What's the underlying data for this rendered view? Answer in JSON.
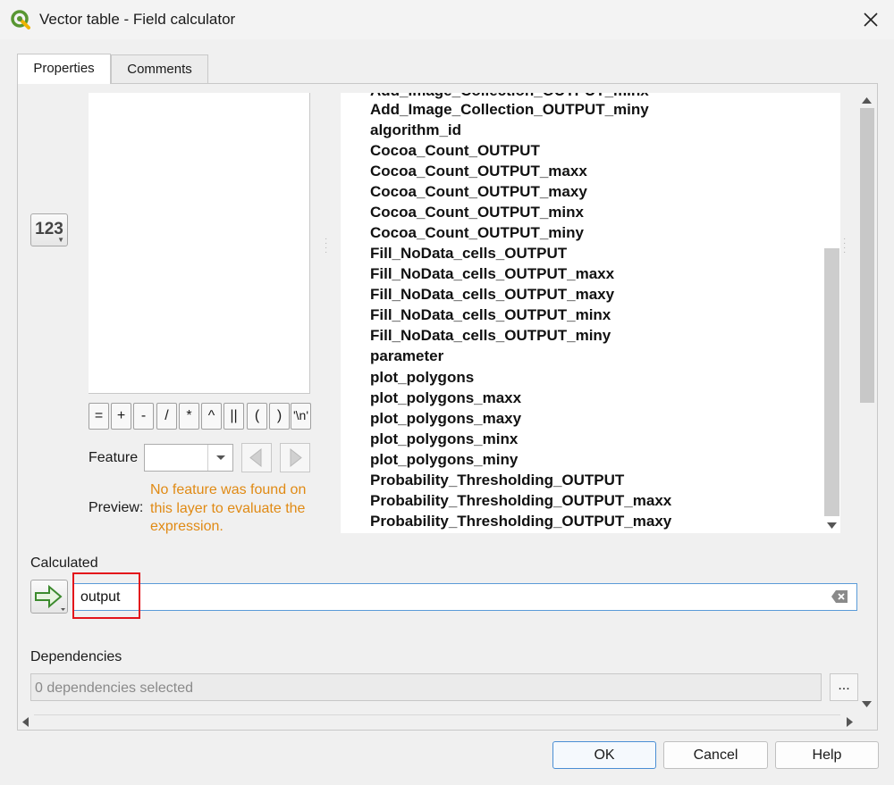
{
  "window": {
    "title": "Vector table - Field calculator",
    "app_icon": "qgis-logo-icon",
    "close_icon": "close-icon"
  },
  "tabs": [
    {
      "label": "Properties",
      "active": true
    },
    {
      "label": "Comments",
      "active": false
    }
  ],
  "left": {
    "field_type_button": "123",
    "operators": [
      "=",
      "+",
      "-",
      "/",
      "*",
      "^",
      "||",
      "(",
      ")",
      "'\\n'"
    ],
    "feature_label": "Feature",
    "feature_value": "",
    "preview_label": "Preview:",
    "preview_message": "No feature was found on this layer to evaluate the expression."
  },
  "field_list": {
    "partial_item": "Add_Image_Collection_OUTPUT_minx",
    "items": [
      "Add_Image_Collection_OUTPUT_miny",
      "algorithm_id",
      "Cocoa_Count_OUTPUT",
      "Cocoa_Count_OUTPUT_maxx",
      "Cocoa_Count_OUTPUT_maxy",
      "Cocoa_Count_OUTPUT_minx",
      "Cocoa_Count_OUTPUT_miny",
      "Fill_NoData_cells_OUTPUT",
      "Fill_NoData_cells_OUTPUT_maxx",
      "Fill_NoData_cells_OUTPUT_maxy",
      "Fill_NoData_cells_OUTPUT_minx",
      "Fill_NoData_cells_OUTPUT_miny",
      "parameter",
      "plot_polygons",
      "plot_polygons_maxx",
      "plot_polygons_maxy",
      "plot_polygons_minx",
      "plot_polygons_miny",
      "Probability_Thresholding_OUTPUT",
      "Probability_Thresholding_OUTPUT_maxx",
      "Probability_Thresholding_OUTPUT_maxy"
    ]
  },
  "calculated": {
    "label": "Calculated",
    "value": "output",
    "highlight_color": "#e3141b"
  },
  "dependencies": {
    "label": "Dependencies",
    "placeholder": "0 dependencies selected",
    "browse_label": "..."
  },
  "buttons": {
    "ok": "OK",
    "cancel": "Cancel",
    "help": "Help"
  },
  "colors": {
    "preview_message": "#e08a14",
    "accent": "#4a8ed4"
  }
}
